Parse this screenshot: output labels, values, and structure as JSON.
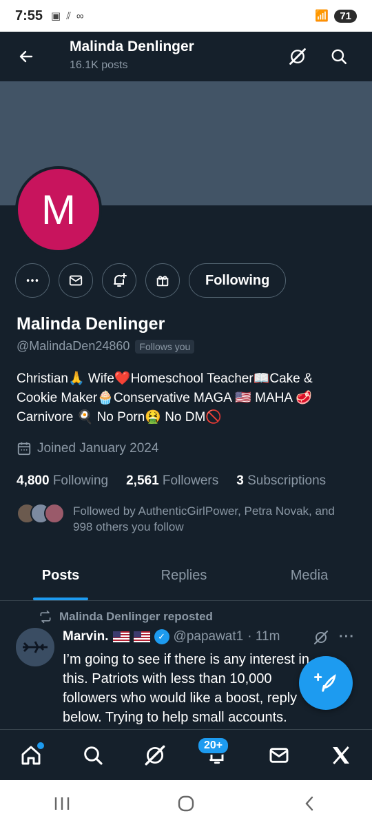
{
  "status_bar": {
    "time": "7:55",
    "battery": "71"
  },
  "header": {
    "title": "Malinda Denlinger",
    "subtitle": "16.1K posts"
  },
  "avatar": {
    "letter": "M"
  },
  "actions": {
    "following_label": "Following"
  },
  "profile": {
    "name": "Malinda Denlinger",
    "handle": "@MalindaDen24860",
    "follows_you": "Follows you",
    "bio": "Christian🙏 Wife❤️Homeschool Teacher📖Cake & Cookie Maker🧁Conservative MAGA 🇺🇸 MAHA 🥩 Carnivore 🍳 No Porn🤮 No DM🚫",
    "joined": "Joined January 2024"
  },
  "stats": {
    "following_count": "4,800",
    "following_label": "Following",
    "followers_count": "2,561",
    "followers_label": "Followers",
    "subscriptions_count": "3",
    "subscriptions_label": "Subscriptions"
  },
  "followed_by": "Followed by AuthenticGirlPower, Petra Novak, and 998 others you follow",
  "tabs": [
    "Posts",
    "Replies",
    "Media"
  ],
  "post": {
    "repost_label": "Malinda Denlinger reposted",
    "author_name": "Marvin.",
    "author_handle": "@papawat1",
    "time": "· 11m",
    "text": "I’m going to see if there is any interest in this. Patriots with less than 10,000 followers who would like a boost, reply below. Trying to help small accounts."
  },
  "bottom_nav": {
    "notifications_badge": "20+"
  },
  "colors": {
    "background": "#15202b",
    "accent": "#1d9bf0",
    "avatar": "#c8145d",
    "banner": "#425466",
    "muted": "#8b98a5"
  }
}
